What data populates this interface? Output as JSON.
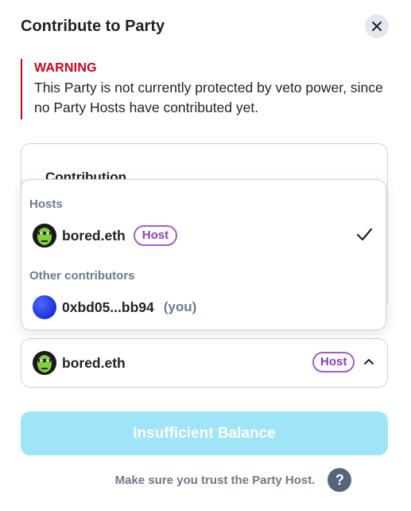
{
  "modal": {
    "title": "Contribute to Party",
    "close_icon": "close-icon"
  },
  "warning": {
    "title": "WARNING",
    "text": "This Party is not currently protected by veto power, since no Party Hosts have contributed yet."
  },
  "contribution": {
    "label": "Contribution"
  },
  "dropdown": {
    "hosts_label": "Hosts",
    "others_label": "Other contributors",
    "hosts": [
      {
        "name": "bored.eth",
        "badge": "Host",
        "selected": true,
        "avatar": "bored-ape-avatar"
      }
    ],
    "others": [
      {
        "name": "0xbd05...bb94",
        "suffix": "(you)",
        "avatar": "blue-orb-avatar"
      }
    ]
  },
  "delegate_select": {
    "value": "bored.eth",
    "badge": "Host",
    "avatar": "bored-ape-avatar",
    "icon": "chevron-up-icon"
  },
  "submit": {
    "label": "Insufficient Balance",
    "disabled": true
  },
  "footer": {
    "text": "Make sure you trust the Party Host.",
    "help_icon": "?"
  },
  "colors": {
    "warning": "#d0021b",
    "host_badge": "#a45bd1",
    "submit_disabled": "#9fe4f7",
    "muted_text": "#6b7a8c"
  }
}
